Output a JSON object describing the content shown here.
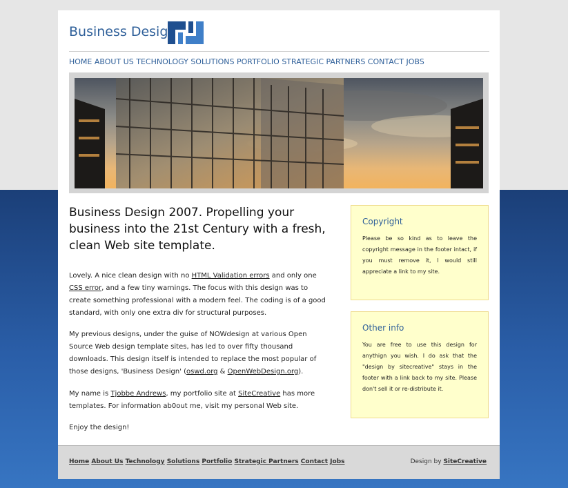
{
  "site": {
    "title": "Business Design"
  },
  "nav": {
    "items": [
      "HOME",
      "ABOUT US",
      "TECHNOLOGY",
      "SOLUTIONS",
      "PORTFOLIO",
      "STRATEGIC PARTNERS",
      "CONTACT",
      "JOBS"
    ]
  },
  "main": {
    "headline": "Business Design 2007. Propelling your business into the 21st Century with a fresh, clean Web site template.",
    "p1": {
      "a": "Lovely. A nice clean design with no ",
      "link1": "HTML Validation errors",
      "b": " and only one ",
      "link2": "CSS error",
      "c": ", and a few tiny warnings. The focus with this design was to create something professional with a modern feel. The coding is of a good standard, with only one extra div for structural purposes."
    },
    "p2": {
      "a": "My previous designs, under the guise of NOWdesign at various Open Source Web design template sites, has led to over fifty thousand downloads. This design itself is intended to replace the most popular of those designs, 'Business Design' (",
      "link1": "oswd.org",
      "b": " & ",
      "link2": "OpenWebDesign.org",
      "c": ")."
    },
    "p3": {
      "a": "My name is ",
      "link1": "Tjobbe Andrews",
      "b": ", my portfolio site at ",
      "link2": "SiteCreative",
      "c": " has more templates. For information ab0out me, visit my personal Web site."
    },
    "p4": "Enjoy the design!"
  },
  "sidebar": {
    "copyright": {
      "title": "Copyright",
      "text": "Please be so kind as to leave the copyright message in the footer intact, if you must remove it, I would still appreciate a link to my site."
    },
    "other": {
      "title": "Other info",
      "text": "You are free to use this design for anythign you wish. I do ask that the \"design by sitecreative\" stays in the footer with a link back to my site. Please don't sell it or re-distribute it."
    }
  },
  "footer": {
    "links": [
      "Home",
      "About Us",
      "Technology",
      "Solutions",
      "Portfolio",
      "Strategic Partners",
      "Contact",
      "Jobs"
    ],
    "credit_prefix": "Design by ",
    "credit_link": "SiteCreative"
  },
  "colors": {
    "accent": "#2e5f99",
    "page_bg_top": "#e6e6e6",
    "page_bg_bottom": "#1f4a8a",
    "sidebar_box": "#ffffcc",
    "footer": "#d9d9d9"
  }
}
